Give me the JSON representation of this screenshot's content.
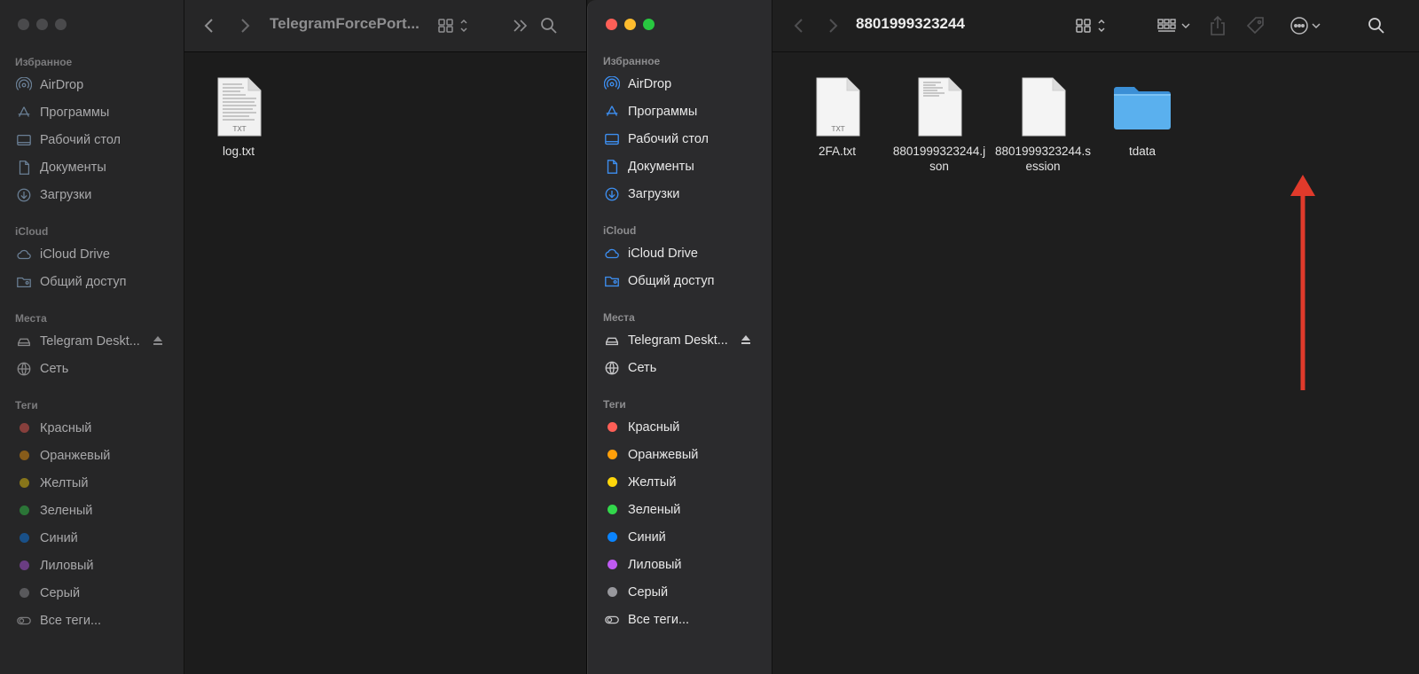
{
  "sidebar": {
    "favorites_title": "Избранное",
    "favorites": [
      {
        "label": "AirDrop",
        "icon": "airdrop-icon"
      },
      {
        "label": "Программы",
        "icon": "applications-icon"
      },
      {
        "label": "Рабочий стол",
        "icon": "desktop-icon"
      },
      {
        "label": "Документы",
        "icon": "documents-icon"
      },
      {
        "label": "Загрузки",
        "icon": "downloads-icon"
      }
    ],
    "icloud_title": "iCloud",
    "icloud": [
      {
        "label": "iCloud Drive",
        "icon": "icloud-icon"
      },
      {
        "label": "Общий доступ",
        "icon": "shared-folder-icon"
      }
    ],
    "places_title": "Места",
    "places": [
      {
        "label": "Telegram Deskt...",
        "icon": "drive-icon"
      },
      {
        "label": "Сеть",
        "icon": "network-icon"
      }
    ],
    "tags_title": "Теги",
    "tags": [
      {
        "label": "Красный",
        "color": "#ff5f57"
      },
      {
        "label": "Оранжевый",
        "color": "#ff9f0a"
      },
      {
        "label": "Желтый",
        "color": "#ffd60a"
      },
      {
        "label": "Зеленый",
        "color": "#32d74b"
      },
      {
        "label": "Синий",
        "color": "#0a84ff"
      },
      {
        "label": "Лиловый",
        "color": "#bf5af2"
      },
      {
        "label": "Серый",
        "color": "#98989d"
      }
    ],
    "all_tags": "Все теги..."
  },
  "left_window": {
    "title": "TelegramForcePort...",
    "files": [
      {
        "name": "log.txt",
        "type": "txt-file-icon"
      }
    ]
  },
  "right_window": {
    "title": "8801999323244",
    "files": [
      {
        "name": "2FA.txt",
        "type": "txt-file-icon"
      },
      {
        "name": "8801999323244.json",
        "type": "json-file-icon"
      },
      {
        "name": "8801999323244.session",
        "type": "session-file-icon"
      },
      {
        "name": "tdata",
        "type": "folder-icon"
      }
    ]
  },
  "colors": {
    "accent_folder": "#5ab0ee",
    "arrow": "#e03a2b",
    "close": "#ff5f57",
    "minimize": "#febc2e",
    "zoom": "#28c840"
  }
}
